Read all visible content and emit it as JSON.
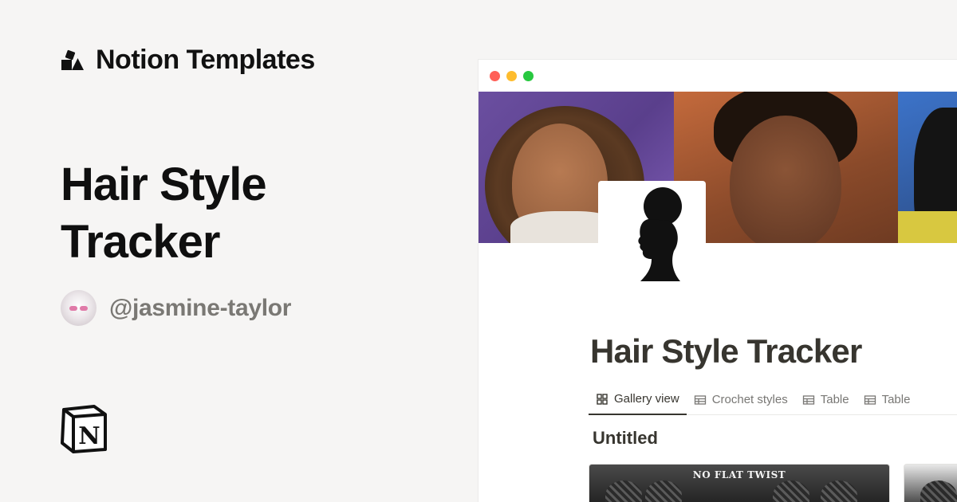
{
  "brand": {
    "name": "Notion Templates"
  },
  "hero": {
    "title": "Hair Style Tracker"
  },
  "author": {
    "handle": "@jasmine-taylor"
  },
  "window": {
    "dots": {
      "close": "#ff5f57",
      "minimize": "#febc2e",
      "zoom": "#28c840"
    },
    "doc_title": "Hair Style Tracker",
    "tabs": [
      {
        "label": "Gallery view",
        "icon": "gallery-icon",
        "active": true
      },
      {
        "label": "Crochet styles",
        "icon": "table-icon",
        "active": false
      },
      {
        "label": "Table",
        "icon": "table-icon",
        "active": false
      },
      {
        "label": "Table",
        "icon": "table-icon",
        "active": false
      }
    ],
    "section_title": "Untitled",
    "cards": [
      {
        "caption": "NO FLAT TWIST"
      },
      {
        "caption": ""
      }
    ]
  },
  "colors": {
    "background": "#f6f5f4",
    "text_primary": "#37352f",
    "text_secondary": "#787774",
    "handle": "#7a7874"
  }
}
